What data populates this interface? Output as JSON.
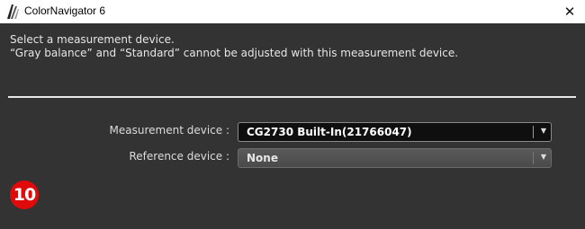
{
  "window": {
    "title": "ColorNavigator 6",
    "app_icon": "colornavigator-logo-icon",
    "close_icon": "close-icon"
  },
  "instruction": {
    "line1": "Select a measurement device.",
    "line2": "“Gray balance” and “Standard” cannot be adjusted with this measurement device."
  },
  "measurement_device": {
    "label": "Measurement device :",
    "value": "CG2730 Built-In(21766047)",
    "arrow_icon": "chevron-down-icon"
  },
  "reference_device": {
    "label": "Reference device :",
    "value": "None",
    "arrow_icon": "chevron-down-icon"
  },
  "step_badge": {
    "number": "10",
    "color": "#e10a0a"
  }
}
